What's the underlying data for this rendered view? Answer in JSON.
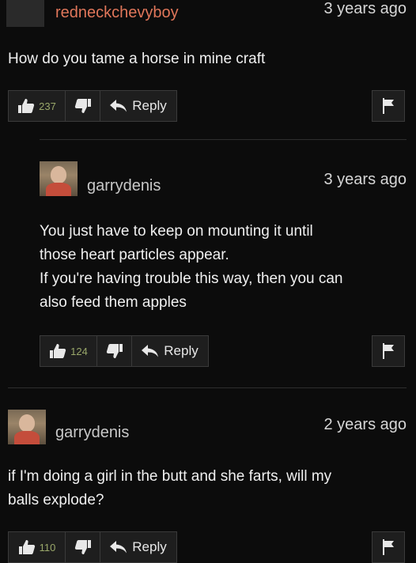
{
  "comments": [
    {
      "username": "redneckchevyboy",
      "timestamp": "3 years ago",
      "text": "How do you tame a horse in mine craft",
      "likes": "237",
      "reply_label": "Reply"
    },
    {
      "username": "garrydenis",
      "timestamp": "3 years ago",
      "text": "You just have to keep on mounting it until\nthose heart particles appear.\nIf you're having trouble this way, then you can\nalso feed them apples",
      "likes": "124",
      "reply_label": "Reply"
    },
    {
      "username": "garrydenis",
      "timestamp": "2 years ago",
      "text": "if I'm doing a girl in the butt and she farts, will my\nballs explode?",
      "likes": "110",
      "reply_label": "Reply"
    }
  ],
  "icons": {
    "like": "thumbs-up-icon",
    "dislike": "thumbs-down-icon",
    "reply": "reply-arrow-icon",
    "flag": "flag-icon"
  },
  "colors": {
    "background": "#0c0c0c",
    "username_top": "#e0765a",
    "username_reply": "#c8c8c8",
    "like_count": "#9aa86a"
  }
}
